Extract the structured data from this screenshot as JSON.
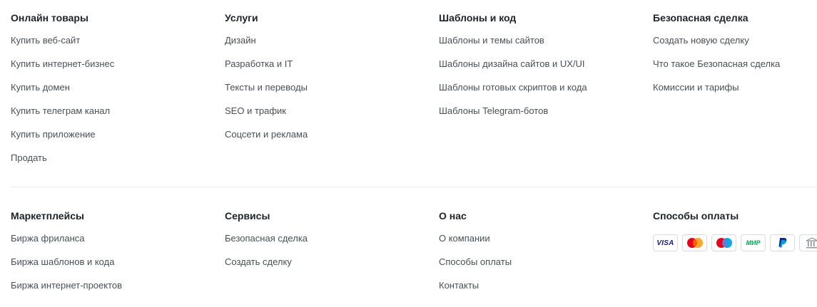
{
  "footer": {
    "top_row": [
      {
        "title": "Онлайн товары",
        "links": [
          "Купить веб-сайт",
          "Купить интернет-бизнес",
          "Купить домен",
          "Купить телеграм канал",
          "Купить приложение",
          "Продать"
        ]
      },
      {
        "title": "Услуги",
        "links": [
          "Дизайн",
          "Разработка и IT",
          "Тексты и переводы",
          "SEO и трафик",
          "Соцсети и реклама"
        ]
      },
      {
        "title": "Шаблоны и код",
        "links": [
          "Шаблоны и темы сайтов",
          "Шаблоны дизайна сайтов и UX/UI",
          "Шаблоны готовых скриптов и кода",
          "Шаблоны Telegram-ботов"
        ]
      },
      {
        "title": "Безопасная сделка",
        "links": [
          "Создать новую сделку",
          "Что такое Безопасная сделка",
          "Комиссии и тарифы"
        ]
      }
    ],
    "bottom_row": [
      {
        "title": "Маркетплейсы",
        "links": [
          "Биржа фриланса",
          "Биржа шаблонов и кода",
          "Биржа интернет-проектов"
        ]
      },
      {
        "title": "Сервисы",
        "links": [
          "Безопасная сделка",
          "Создать сделку"
        ]
      },
      {
        "title": "О нас",
        "links": [
          "О компании",
          "Способы оплаты",
          "Контакты"
        ]
      }
    ],
    "payments": {
      "title": "Способы оплаты",
      "methods": [
        {
          "name": "visa-icon",
          "label": "VISA",
          "color": "#1a1f71"
        },
        {
          "name": "mastercard-icon",
          "colors": [
            "#eb001b",
            "#f79e1b"
          ]
        },
        {
          "name": "maestro-icon",
          "colors": [
            "#eb001b",
            "#0099df"
          ]
        },
        {
          "name": "mir-icon",
          "label": "МИР",
          "color": "#0f9d58"
        },
        {
          "name": "paypal-icon",
          "colors": [
            "#003087",
            "#009cde"
          ]
        },
        {
          "name": "bank-icon",
          "color": "#8a8f98"
        }
      ]
    }
  }
}
